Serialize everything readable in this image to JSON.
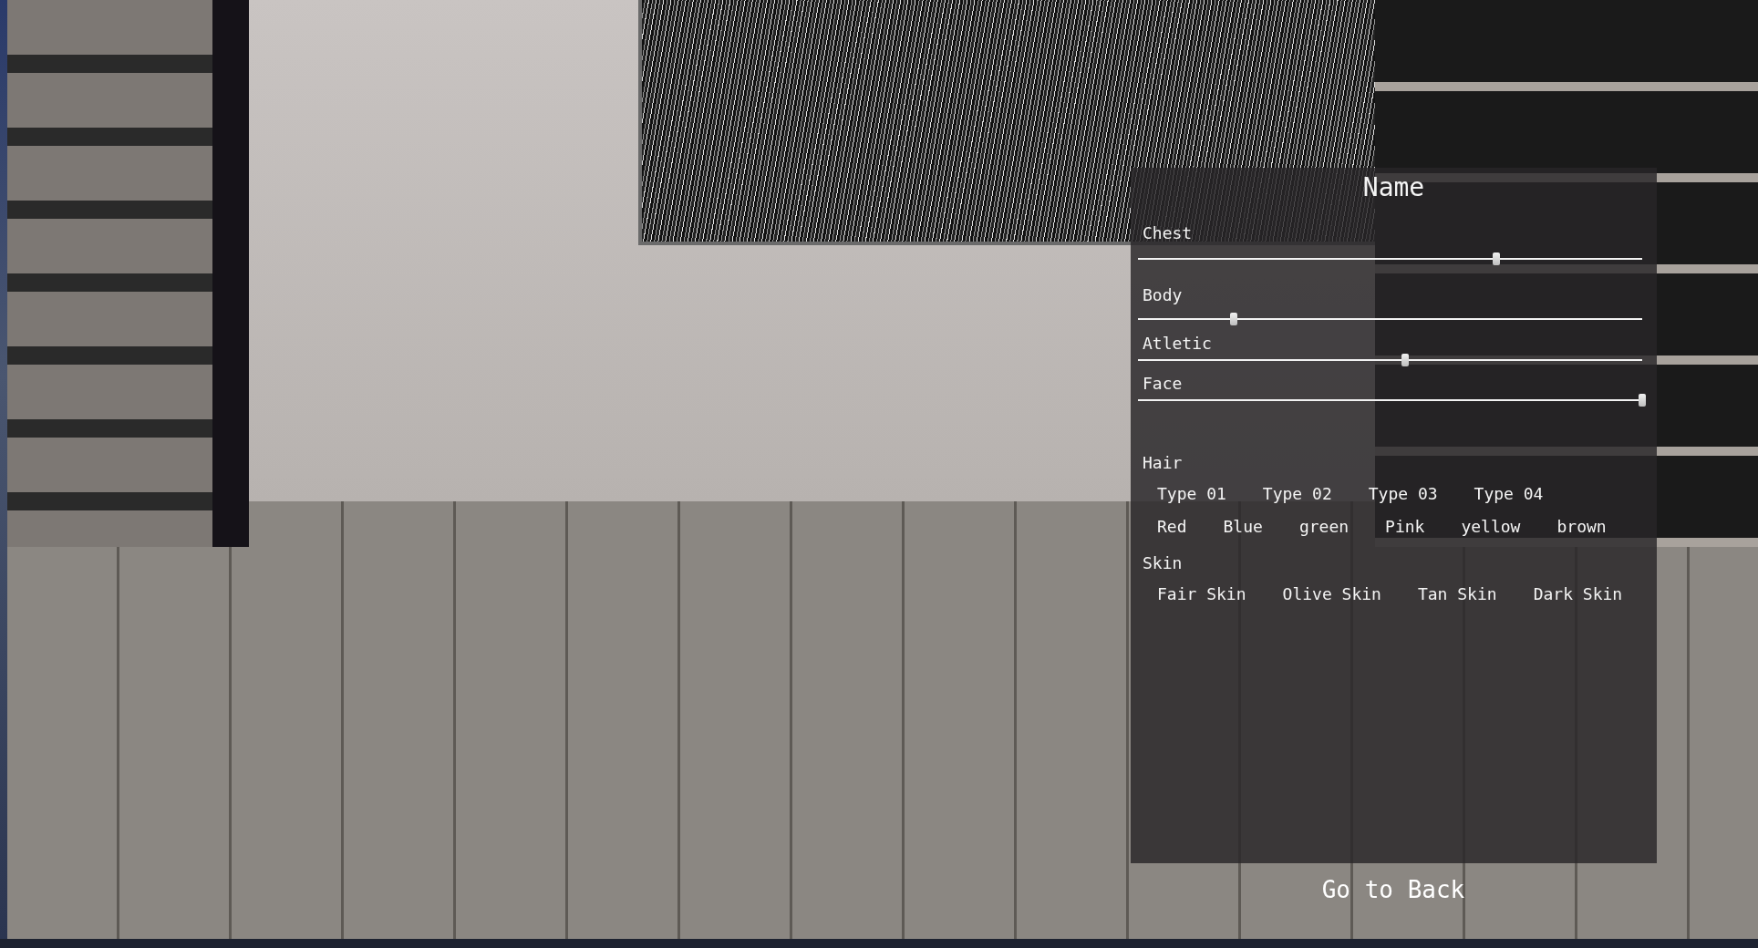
{
  "panel": {
    "title": "Name",
    "sliders": [
      {
        "label": "Chest",
        "level": 0.71
      },
      {
        "label": "Body",
        "level": 0.19
      },
      {
        "label": "Atletic",
        "level": 0.53
      },
      {
        "label": "Face",
        "level": 1.0
      }
    ],
    "hair": {
      "label": "Hair",
      "types": [
        "Type 01",
        "Type 02",
        "Type 03",
        "Type 04"
      ],
      "colors": [
        "Red",
        "Blue",
        "green",
        "Pink",
        "yellow",
        "brown"
      ]
    },
    "skin": {
      "label": "Skin",
      "options": [
        "Fair Skin",
        "Olive Skin",
        "Tan Skin",
        "Dark Skin"
      ]
    }
  },
  "back_button": "Go to Back"
}
